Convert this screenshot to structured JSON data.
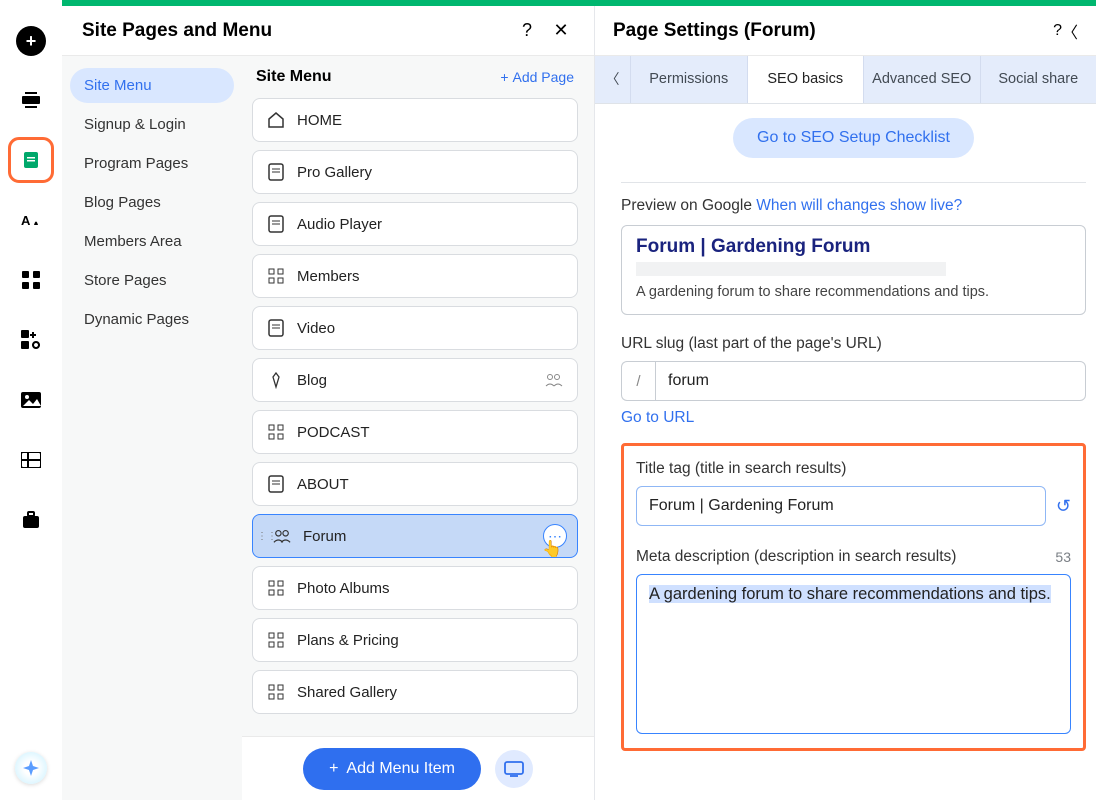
{
  "left_panel": {
    "title": "Site Pages and Menu",
    "categories": [
      "Site Menu",
      "Signup & Login",
      "Program Pages",
      "Blog Pages",
      "Members Area",
      "Store Pages",
      "Dynamic Pages"
    ],
    "main_heading": "Site Menu",
    "add_page_label": "Add Page",
    "pages": [
      "HOME",
      "Pro Gallery",
      "Audio Player",
      "Members",
      "Video",
      "Blog",
      "PODCAST",
      "ABOUT",
      "Forum",
      "Photo Albums",
      "Plans & Pricing",
      "Shared Gallery"
    ],
    "add_menu_item": "Add Menu Item"
  },
  "right_panel": {
    "title": "Page Settings (Forum)",
    "tabs": {
      "permissions": "Permissions",
      "seo_basics": "SEO basics",
      "advanced_seo": "Advanced SEO",
      "social_share": "Social share"
    },
    "seo_checklist": "Go to SEO Setup Checklist",
    "preview_label": "Preview on Google",
    "preview_link": "When will changes show live?",
    "preview_title": "Forum | Gardening Forum",
    "preview_desc": "A gardening forum to share recommendations and tips.",
    "url_slug_label": "URL slug (last part of the page's URL)",
    "url_slug_value": "forum",
    "go_to_url": "Go to URL",
    "title_tag_label": "Title tag (title in search results)",
    "title_tag_value": "Forum | Gardening Forum",
    "meta_label": "Meta description (description in search results)",
    "meta_count": "53",
    "meta_value": "A gardening forum to share recommendations and tips."
  }
}
